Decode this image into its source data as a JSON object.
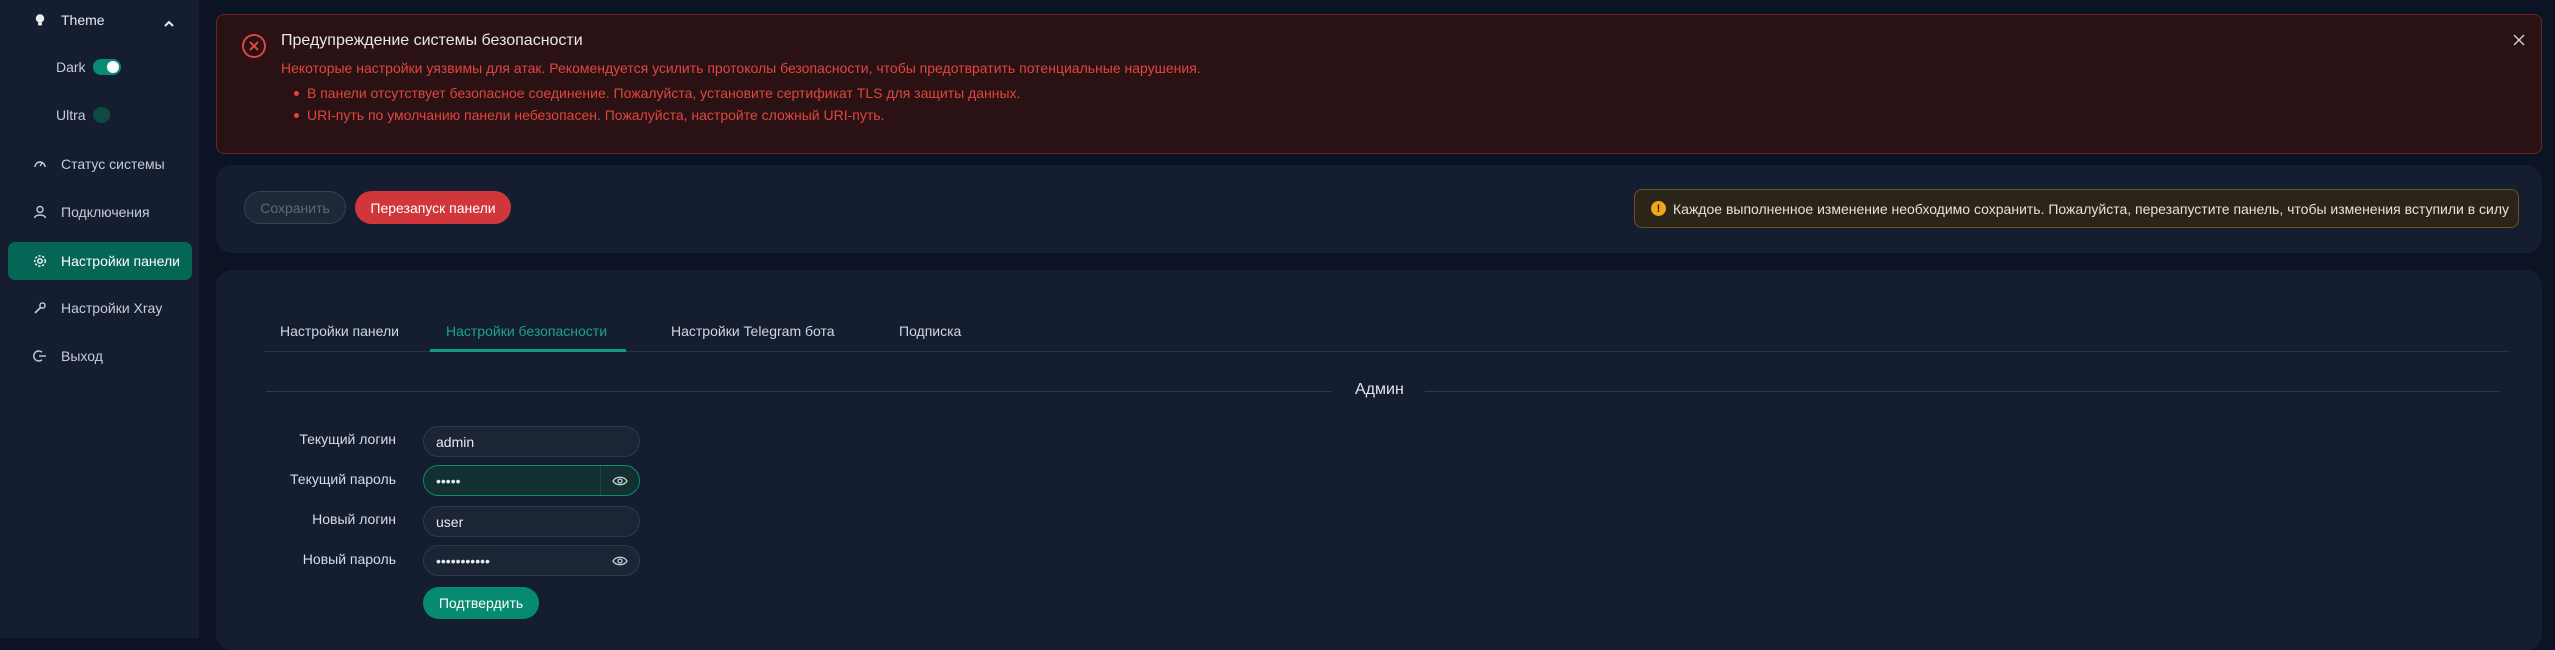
{
  "sidebar": {
    "theme_label": "Theme",
    "dark_label": "Dark",
    "dark_on": true,
    "ultra_label": "Ultra",
    "ultra_on": false,
    "items": [
      {
        "label": "Статус системы",
        "icon": "dashboard-icon"
      },
      {
        "label": "Подключения",
        "icon": "user-icon"
      },
      {
        "label": "Настройки панели",
        "icon": "gear-icon",
        "active": true
      },
      {
        "label": "Настройки Xray",
        "icon": "wrench-icon"
      },
      {
        "label": "Выход",
        "icon": "logout-icon"
      }
    ]
  },
  "alert": {
    "title": "Предупреждение системы безопасности",
    "description": "Некоторые настройки уязвимы для атак. Рекомендуется усилить протоколы безопасности, чтобы предотвратить потенциальные нарушения.",
    "items": [
      "В панели отсутствует безопасное соединение. Пожалуйста, установите сертификат TLS для защиты данных.",
      "URI-путь по умолчанию панели небезопасен. Пожалуйста, настройте сложный URI-путь."
    ],
    "color": "#e0463f"
  },
  "actions": {
    "save_label": "Сохранить",
    "restart_label": "Перезапуск панели",
    "notice": "Каждое выполненное изменение необходимо сохранить. Пожалуйста, перезапустите панель, чтобы изменения вступили в силу"
  },
  "tabs": [
    {
      "label": "Настройки панели"
    },
    {
      "label": "Настройки безопасности",
      "active": true
    },
    {
      "label": "Настройки Telegram бота"
    },
    {
      "label": "Подписка"
    }
  ],
  "admin": {
    "section_title": "Админ",
    "current_login_label": "Текущий логин",
    "current_login_value": "admin",
    "current_password_label": "Текущий пароль",
    "current_password_value": "•••••",
    "new_login_label": "Новый логин",
    "new_login_value": "user",
    "new_password_label": "Новый пароль",
    "new_password_value": "•••••••••••",
    "confirm_label": "Подтвердить"
  },
  "colors": {
    "accent": "#066656",
    "danger": "#d1363a",
    "warning": "#f2a516"
  }
}
